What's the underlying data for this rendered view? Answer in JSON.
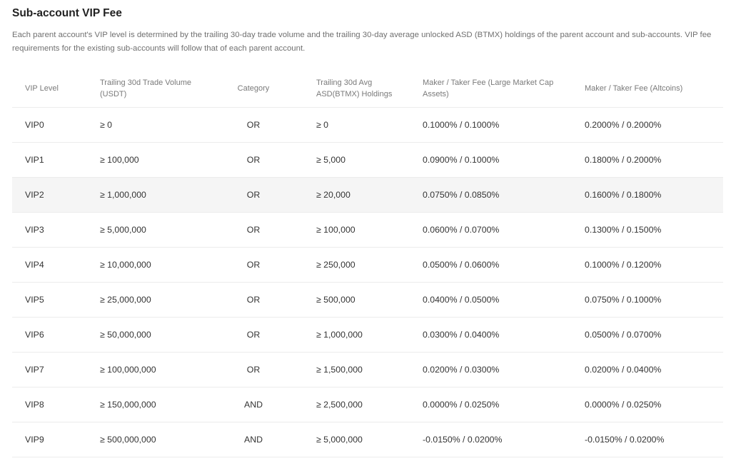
{
  "title": "Sub-account VIP Fee",
  "description": "Each parent account's VIP level is determined by the trailing 30-day trade volume and the trailing 30-day average unlocked ASD (BTMX) holdings of the parent account and sub-accounts. VIP fee requirements for the existing sub-accounts will follow that of each parent account.",
  "table": {
    "headers": [
      "VIP Level",
      "Trailing 30d Trade Volume (USDT)",
      "Category",
      "Trailing 30d Avg ASD(BTMX) Holdings",
      "Maker / Taker Fee (Large Market Cap Assets)",
      "Maker / Taker Fee (Altcoins)"
    ],
    "rows": [
      [
        "VIP0",
        "≥ 0",
        "OR",
        "≥ 0",
        "0.1000% / 0.1000%",
        "0.2000% / 0.2000%"
      ],
      [
        "VIP1",
        "≥ 100,000",
        "OR",
        "≥ 5,000",
        "0.0900% / 0.1000%",
        "0.1800% / 0.2000%"
      ],
      [
        "VIP2",
        "≥ 1,000,000",
        "OR",
        "≥ 20,000",
        "0.0750% / 0.0850%",
        "0.1600% / 0.1800%"
      ],
      [
        "VIP3",
        "≥ 5,000,000",
        "OR",
        "≥ 100,000",
        "0.0600% / 0.0700%",
        "0.1300% / 0.1500%"
      ],
      [
        "VIP4",
        "≥ 10,000,000",
        "OR",
        "≥ 250,000",
        "0.0500% / 0.0600%",
        "0.1000% / 0.1200%"
      ],
      [
        "VIP5",
        "≥ 25,000,000",
        "OR",
        "≥ 500,000",
        "0.0400% / 0.0500%",
        "0.0750% / 0.1000%"
      ],
      [
        "VIP6",
        "≥ 50,000,000",
        "OR",
        "≥ 1,000,000",
        "0.0300% / 0.0400%",
        "0.0500% / 0.0700%"
      ],
      [
        "VIP7",
        "≥ 100,000,000",
        "OR",
        "≥ 1,500,000",
        "0.0200% / 0.0300%",
        "0.0200% / 0.0400%"
      ],
      [
        "VIP8",
        "≥ 150,000,000",
        "AND",
        "≥ 2,500,000",
        "0.0000% / 0.0250%",
        "0.0000% / 0.0250%"
      ],
      [
        "VIP9",
        "≥ 500,000,000",
        "AND",
        "≥ 5,000,000",
        "-0.0150% / 0.0200%",
        "-0.0150% / 0.0200%"
      ]
    ],
    "highlighted_row": 2
  },
  "colors": {
    "text": "#333333",
    "muted": "#707070",
    "border": "#ececec",
    "row_highlight": "#f5f5f5"
  }
}
